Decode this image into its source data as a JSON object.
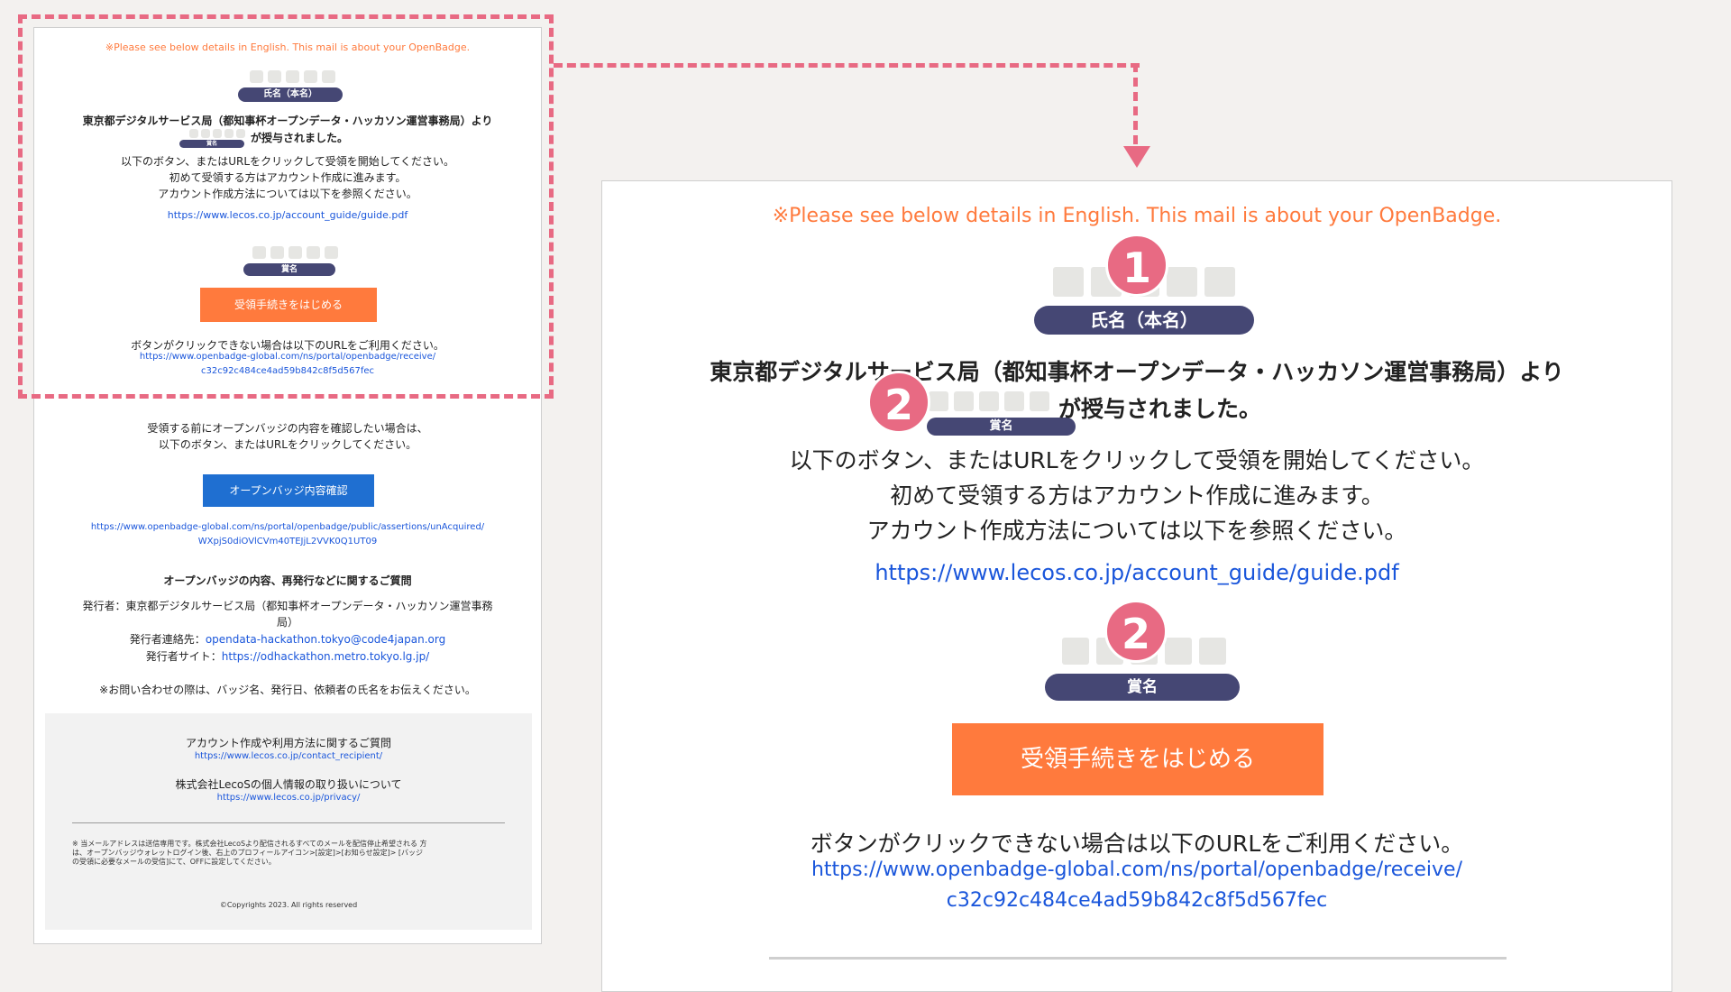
{
  "small_email": {
    "notice": "※Please see below details in English. This mail is about your OpenBadge.",
    "name_label": "氏名（本名）",
    "issuer_line": "東京都デジタルサービス局（都知事杯オープンデータ・ハッカソン運営事務局）より",
    "award_label_small": "賞名",
    "granted_line": "が授与されました。",
    "instructions": [
      "以下のボタン、またはURLをクリックして受領を開始してください。",
      "初めて受領する方はアカウント作成に進みます。",
      "アカウント作成方法については以下を参照ください。"
    ],
    "guide_link": "https://www.lecos.co.jp/account_guide/guide.pdf",
    "award_label": "賞名",
    "start_button": "受領手続きをはじめる",
    "fallback_text": "ボタンがクリックできない場合は以下のURLをご利用ください。",
    "receive_link_1": "https://www.openbadge-global.com/ns/portal/openbadge/receive/",
    "receive_link_2": "c32c92c484ce4ad59b842c8f5d567fec",
    "confirm_lines": [
      "受領する前にオープンバッジの内容を確認したい場合は、",
      "以下のボタン、またはURLをクリックしてください。"
    ],
    "confirm_button": "オープンバッジ内容確認",
    "assertion_link_1": "https://www.openbadge-global.com/ns/portal/openbadge/public/assertions/unAcquired/",
    "assertion_link_2": "WXpjS0diOVlCVm40TEJjL2VVK0Q1UT09",
    "faq_heading": "オープンバッジの内容、再発行などに関するご質問",
    "issuer_label_1": "発行者：東京都デジタルサービス局（都知事杯オープンデータ・ハッカソン運営事務",
    "issuer_label_2": "局）",
    "contact_label": "発行者連絡先：",
    "contact_email": "opendata-hackathon.tokyo@code4japan.org",
    "site_label": "発行者サイト：",
    "site_url": "https://odhackathon.metro.tokyo.lg.jp/",
    "inquiry_note": "※お問い合わせの際は、バッジ名、発行日、依頼者の氏名をお伝えください。",
    "account_q": "アカウント作成や利用方法に関するご質問",
    "account_q_link": "https://www.lecos.co.jp/contact_recipient/",
    "privacy_text": "株式会社LecoSの個人情報の取り扱いについて",
    "privacy_link": "https://www.lecos.co.jp/privacy/",
    "disclaimer": [
      "※ 当メールアドレスは送信専用です。株式会社LecoSより配信されるすべてのメールを配信停止希望される 方",
      "は、オープンバッジウォレットログイン後、右上のプロフィールアイコン>[設定]>[お知らせ設定]> [バッジ",
      "の受領に必要なメールの受信]にて、OFFに設定してください。"
    ],
    "copyright": "©Copyrights 2023. All rights reserved"
  },
  "zoom": {
    "notice": "※Please see below details in English. This mail is about your OpenBadge.",
    "badge_1": "1",
    "badge_2a": "2",
    "badge_2b": "2",
    "name_label": "氏名（本名）",
    "issuer_line": "東京都デジタルサービス局（都知事杯オープンデータ・ハッカソン運営事務局）より",
    "award_label_small": "賞名",
    "granted_line": "が授与されました。",
    "instructions": [
      "以下のボタン、またはURLをクリックして受領を開始してください。",
      "初めて受領する方はアカウント作成に進みます。",
      "アカウント作成方法については以下を参照ください。"
    ],
    "guide_link": "https://www.lecos.co.jp/account_guide/guide.pdf",
    "award_label": "賞名",
    "start_button": "受領手続きをはじめる",
    "fallback_text": "ボタンがクリックできない場合は以下のURLをご利用ください。",
    "receive_link_1": "https://www.openbadge-global.com/ns/portal/openbadge/receive/",
    "receive_link_2": "c32c92c484ce4ad59b842c8f5d567fec"
  },
  "colors": {
    "accent_orange": "#ff7a3d",
    "pill_navy": "#454774",
    "link_blue": "#1a56db",
    "confirm_blue": "#1f6fd1",
    "annotation_pink": "#e86a83"
  }
}
